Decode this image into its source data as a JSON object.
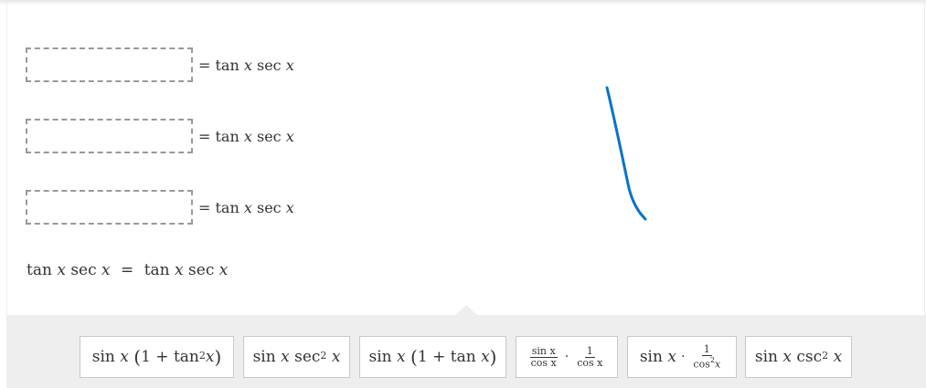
{
  "rows": [
    {
      "equals": "=",
      "tan": "tan",
      "x1": "x",
      "sec": "sec",
      "x2": "x"
    },
    {
      "equals": "=",
      "tan": "tan",
      "x1": "x",
      "sec": "sec",
      "x2": "x"
    },
    {
      "equals": "=",
      "tan": "tan",
      "x1": "x",
      "sec": "sec",
      "x2": "x"
    }
  ],
  "conclusion": {
    "lhs_tan": "tan",
    "lhs_x1": "x",
    "lhs_sec": "sec",
    "lhs_x2": "x",
    "equals": "=",
    "rhs_tan": "tan",
    "rhs_x1": "x",
    "rhs_sec": "sec",
    "rhs_x2": "x"
  },
  "sketch_color": "#0a72c9",
  "tiles": [
    {
      "sin": "sin",
      "x": "x",
      "lparen": "(",
      "one": "1",
      "plus": "+",
      "tan": "tan",
      "exp": "2",
      "x2": "x",
      "rparen": ")"
    },
    {
      "sin": "sin",
      "x": "x",
      "sec": "sec",
      "exp": "2",
      "x2": "x"
    },
    {
      "sin": "sin",
      "x": "x",
      "lparen": "(",
      "one": "1",
      "plus": "+",
      "tan": "tan",
      "x2": "x",
      "rparen": ")"
    },
    {
      "num1": "sin x",
      "den1": "cos x",
      "dot": "·",
      "num2": "1",
      "den2": "cos x"
    },
    {
      "sin": "sin",
      "x": "x",
      "dot": "·",
      "num": "1",
      "den": "cos",
      "den_exp": "2",
      "den_x": "x"
    },
    {
      "sin": "sin",
      "x": "x",
      "csc": "csc",
      "exp": "2",
      "x2": "x"
    }
  ]
}
